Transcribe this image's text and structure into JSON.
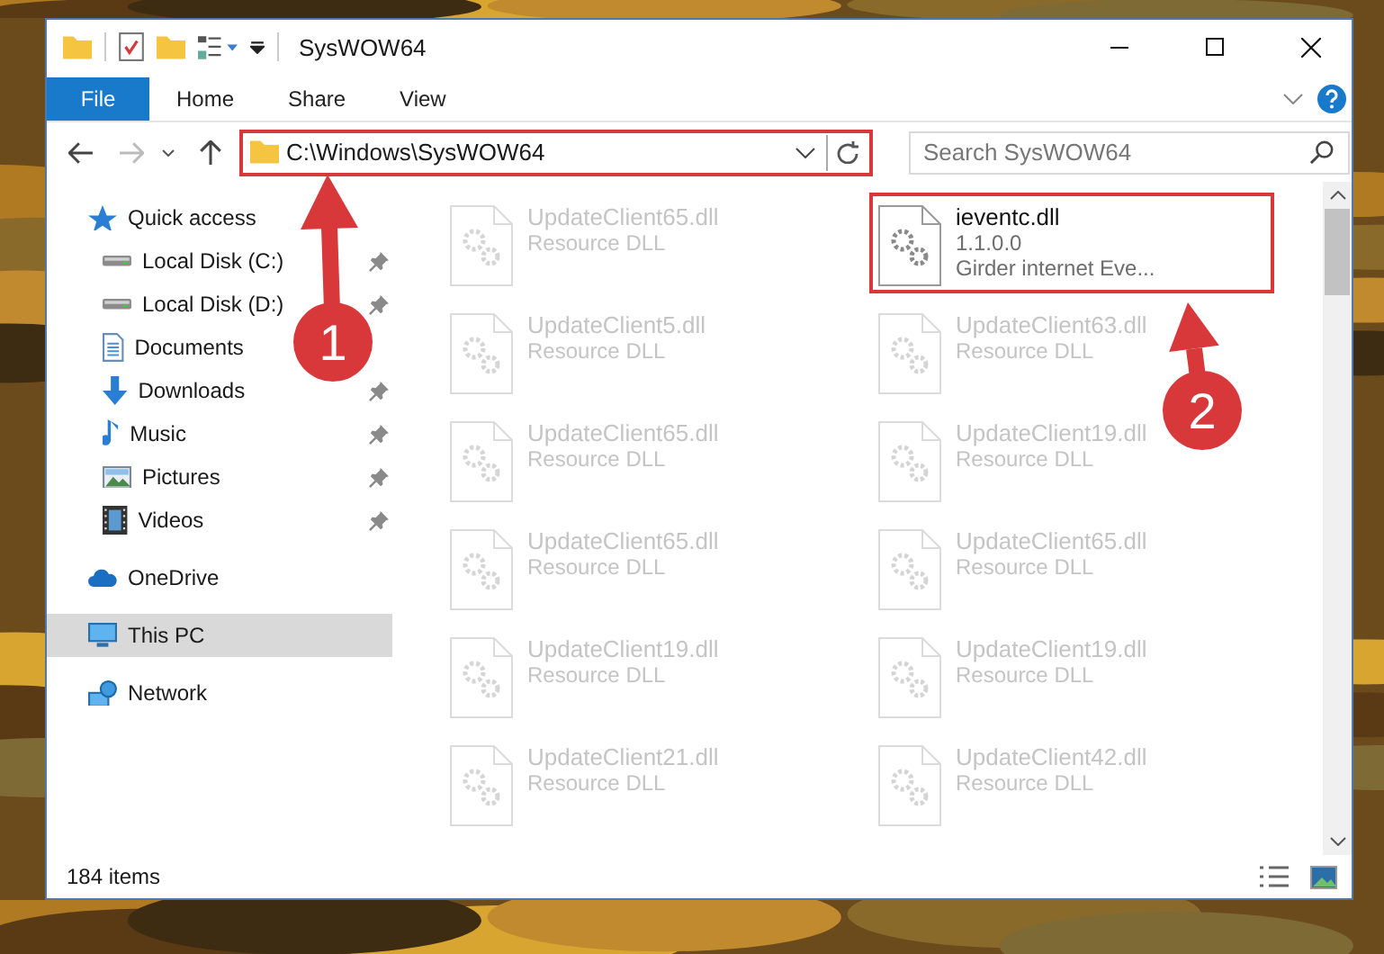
{
  "window": {
    "title": "SysWOW64"
  },
  "ribbon": {
    "tabs": [
      {
        "label": "File",
        "kind": "menu"
      },
      {
        "label": "Home",
        "kind": "tab"
      },
      {
        "label": "Share",
        "kind": "tab"
      },
      {
        "label": "View",
        "kind": "tab"
      }
    ]
  },
  "address_bar": {
    "path": "C:\\Windows\\SysWOW64",
    "highlighted": true
  },
  "search": {
    "placeholder": "Search SysWOW64"
  },
  "sidebar": {
    "items": [
      {
        "label": "Quick access",
        "kind": "star",
        "selected": false,
        "children": [
          {
            "label": "Local Disk (C:)",
            "kind": "drive",
            "pinned": true,
            "selected": false
          },
          {
            "label": "Local Disk (D:)",
            "kind": "drive",
            "pinned": true,
            "selected": false
          },
          {
            "label": "Documents",
            "kind": "documents",
            "pinned": false,
            "selected": false
          },
          {
            "label": "Downloads",
            "kind": "downloads",
            "pinned": true,
            "selected": false
          },
          {
            "label": "Music",
            "kind": "music",
            "pinned": true,
            "selected": false
          },
          {
            "label": "Pictures",
            "kind": "pictures",
            "pinned": true,
            "selected": false
          },
          {
            "label": "Videos",
            "kind": "videos",
            "pinned": true,
            "selected": false
          }
        ]
      },
      {
        "label": "OneDrive",
        "kind": "cloud",
        "selected": false
      },
      {
        "label": "This PC",
        "kind": "pc",
        "selected": true
      },
      {
        "label": "Network",
        "kind": "network",
        "selected": false
      }
    ]
  },
  "files": [
    {
      "name": "UpdateClient65.dll",
      "lines": [
        "Resource DLL"
      ],
      "dimmed": true,
      "highlighted": false
    },
    {
      "name": "ieventc.dll",
      "lines": [
        "1.1.0.0",
        "Girder internet Eve..."
      ],
      "dimmed": false,
      "highlighted": true
    },
    {
      "name": "UpdateClient5.dll",
      "lines": [
        "Resource DLL"
      ],
      "dimmed": true,
      "highlighted": false
    },
    {
      "name": "UpdateClient63.dll",
      "lines": [
        "Resource DLL"
      ],
      "dimmed": true,
      "highlighted": false
    },
    {
      "name": "UpdateClient65.dll",
      "lines": [
        "Resource DLL"
      ],
      "dimmed": true,
      "highlighted": false
    },
    {
      "name": "UpdateClient19.dll",
      "lines": [
        "Resource DLL"
      ],
      "dimmed": true,
      "highlighted": false
    },
    {
      "name": "UpdateClient65.dll",
      "lines": [
        "Resource DLL"
      ],
      "dimmed": true,
      "highlighted": false
    },
    {
      "name": "UpdateClient65.dll",
      "lines": [
        "Resource DLL"
      ],
      "dimmed": true,
      "highlighted": false
    },
    {
      "name": "UpdateClient19.dll",
      "lines": [
        "Resource DLL"
      ],
      "dimmed": true,
      "highlighted": false
    },
    {
      "name": "UpdateClient19.dll",
      "lines": [
        "Resource DLL"
      ],
      "dimmed": true,
      "highlighted": false
    },
    {
      "name": "UpdateClient21.dll",
      "lines": [
        "Resource DLL"
      ],
      "dimmed": true,
      "highlighted": false
    },
    {
      "name": "UpdateClient42.dll",
      "lines": [
        "Resource DLL"
      ],
      "dimmed": true,
      "highlighted": false
    }
  ],
  "annotations": [
    {
      "label": "1"
    },
    {
      "label": "2"
    }
  ],
  "status_bar": {
    "item_count": "184 items"
  }
}
